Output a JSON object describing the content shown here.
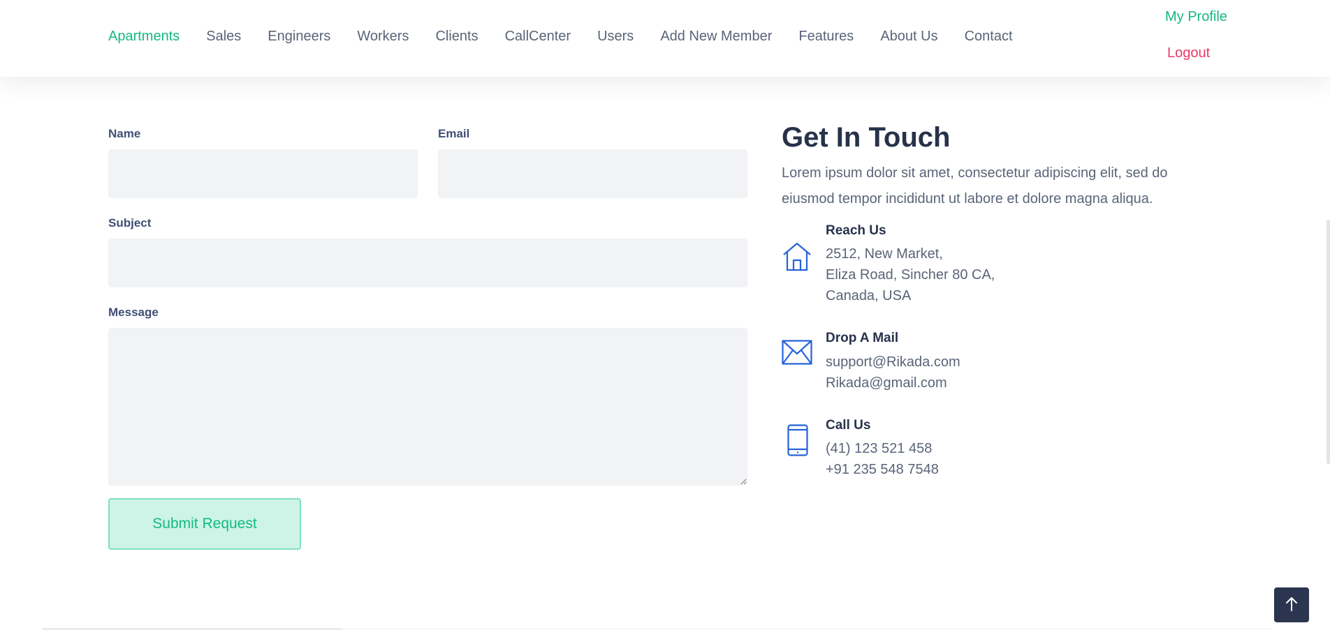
{
  "nav": {
    "items": [
      {
        "label": "Apartments",
        "active": true
      },
      {
        "label": "Sales",
        "active": false
      },
      {
        "label": "Engineers",
        "active": false
      },
      {
        "label": "Workers",
        "active": false
      },
      {
        "label": "Clients",
        "active": false
      },
      {
        "label": "CallCenter",
        "active": false
      },
      {
        "label": "Users",
        "active": false
      },
      {
        "label": "Add New Member",
        "active": false
      },
      {
        "label": "Features",
        "active": false
      },
      {
        "label": "About Us",
        "active": false
      },
      {
        "label": "Contact",
        "active": false
      }
    ],
    "profile_label": "My Profile",
    "logout_label": "Logout"
  },
  "form": {
    "name_label": "Name",
    "name_value": "",
    "email_label": "Email",
    "email_value": "",
    "subject_label": "Subject",
    "subject_value": "",
    "message_label": "Message",
    "message_value": "",
    "submit_label": "Submit Request"
  },
  "contact": {
    "title": "Get In Touch",
    "description": "Lorem ipsum dolor sit amet, consectetur adipiscing elit, sed do eiusmod tempor incididunt ut labore et dolore magna aliqua.",
    "reach": {
      "heading": "Reach Us",
      "icon": "home-icon",
      "lines": [
        "2512, New Market,",
        "Eliza Road, Sincher 80 CA,",
        "Canada, USA"
      ]
    },
    "mail": {
      "heading": "Drop A Mail",
      "icon": "mail-icon",
      "lines": [
        "support@Rikada.com",
        "Rikada@gmail.com"
      ]
    },
    "call": {
      "heading": "Call Us",
      "icon": "phone-icon",
      "lines": [
        "(41) 123 521 458",
        "+91 235 548 7548"
      ]
    }
  },
  "back_to_top_icon": "arrow-up-icon",
  "colors": {
    "accent": "#14b983",
    "logout": "#ea3a6a",
    "icon_blue": "#2563d9",
    "field_bg": "#f2f3f5",
    "button_bg": "#cdf4e6",
    "back_to_top_bg": "#2b3550"
  }
}
